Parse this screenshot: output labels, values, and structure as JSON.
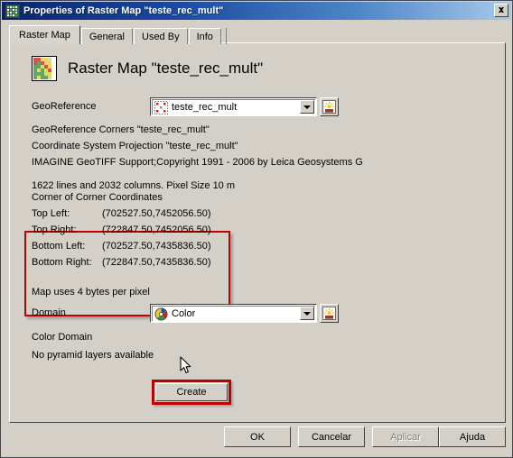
{
  "window": {
    "title": "Properties of Raster Map \"teste_rec_mult\"",
    "title_icon": "raster-map-icon",
    "close_label": "✕"
  },
  "tabs": [
    {
      "label": "Raster Map",
      "active": true
    },
    {
      "label": "General",
      "active": false
    },
    {
      "label": "Used By",
      "active": false
    },
    {
      "label": "Info",
      "active": false
    }
  ],
  "main": {
    "heading": "Raster Map \"teste_rec_mult\"",
    "heading_icon": "raster-grid-icon",
    "georeference": {
      "label": "GeoReference",
      "value": "teste_rec_mult",
      "icon": "georeference-icon",
      "side_button_icon": "sun-properties-icon"
    },
    "info_lines": [
      "GeoReference Corners \"teste_rec_mult\"",
      "Coordinate System Projection \"teste_rec_mult\"",
      "IMAGINE GeoTIFF Support;Copyright 1991 - 2006 by Leica Geosystems G"
    ],
    "dimensions_line": "1622 lines and 2032 columns.  Pixel Size 10 m",
    "corner_coordinates": {
      "title": "Corner of Corner Coordinates",
      "rows": [
        {
          "label": "Top Left:",
          "value": "(702527.50,7452056.50)"
        },
        {
          "label": "Top Right:",
          "value": "(722847.50,7452056.50)"
        },
        {
          "label": "Bottom Left:",
          "value": "(702527.50,7435836.50)"
        },
        {
          "label": "Bottom Right:",
          "value": "(722847.50,7435836.50)"
        }
      ],
      "highlight_color": "#c00000"
    },
    "bytes_line": "Map uses 4 bytes per pixel",
    "domain": {
      "label": "Domain",
      "value": "Color",
      "icon": "color-palette-icon",
      "side_button_icon": "sun-properties-icon"
    },
    "color_domain_label": "Color Domain",
    "pyramid_label": "No pyramid layers available",
    "create_button": "Create",
    "create_highlight_color": "#c00000"
  },
  "footer": {
    "ok": "OK",
    "cancel": "Cancelar",
    "apply": "Aplicar",
    "help": "Ajuda"
  }
}
